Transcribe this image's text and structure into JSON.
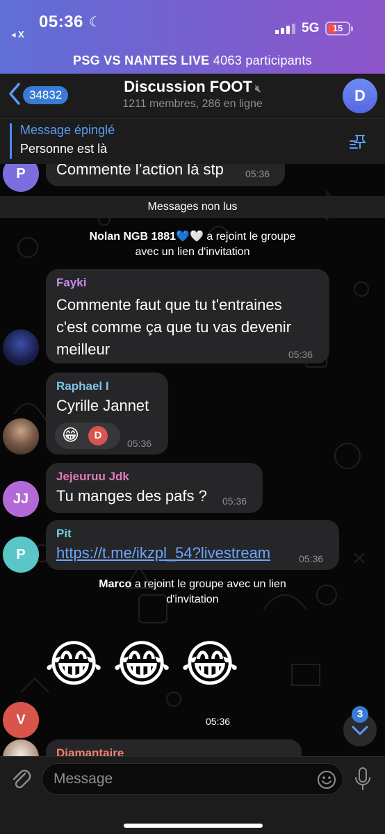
{
  "status_bar": {
    "time": "05:36",
    "back_app": "◂ X",
    "network": "5G",
    "battery": "15"
  },
  "live_banner": {
    "title": "PSG VS NANTES LIVE",
    "participants": "4063 participants"
  },
  "header": {
    "unread_count": "34832",
    "title": "Discussion FOOT",
    "subtitle": "1211 membres, 286 en ligne",
    "avatar_letter": "D"
  },
  "pinned": {
    "label": "Message épinglé",
    "text": "Personne est là"
  },
  "messages": {
    "m0": {
      "avatar": "P",
      "text": "Commente l’action là stp",
      "time": "05:36"
    },
    "unread_divider": "Messages non lus",
    "join1": {
      "name": "Nolan NGB 1881💙🤍",
      "text": "a rejoint le groupe",
      "line2": "avec un lien d'invitation"
    },
    "m1": {
      "name": "Fayki",
      "line1": "Commente faut que tu t'entraines",
      "line2": "c'est comme ça que tu vas devenir",
      "line3": "meilleur",
      "time": "05:36"
    },
    "m2": {
      "name": "Raphael I",
      "text": "Cyrille Jannet",
      "time": "05:36",
      "reaction_emoji": "😁",
      "reaction_user": "D"
    },
    "m3": {
      "avatar": "JJ",
      "name": "Jejeuruu Jdk",
      "text": "Tu manges des pafs ?",
      "time": "05:36"
    },
    "m4": {
      "avatar": "P",
      "name": "Pit",
      "text": "https://t.me/ikzpl_54?livestream",
      "time": "05:36"
    },
    "join2": {
      "name": "Marco",
      "text": "a rejoint le groupe avec un lien",
      "line2": "d'invitation"
    },
    "m5": {
      "avatar": "V",
      "emoji": "😂",
      "time": "05:36"
    },
    "m6": {
      "name": "Diamantaire"
    }
  },
  "scroll_button": {
    "badge": "3"
  },
  "input": {
    "placeholder": "Message"
  },
  "colors": {
    "accent": "#3a7bd5",
    "bubble": "#262628",
    "name_fayki": "#c58cf0",
    "name_raphael": "#7fc6e8",
    "name_jejeuruu": "#e07ab9",
    "name_pit": "#6fd0d7",
    "name_diamantaire": "#f08070"
  }
}
